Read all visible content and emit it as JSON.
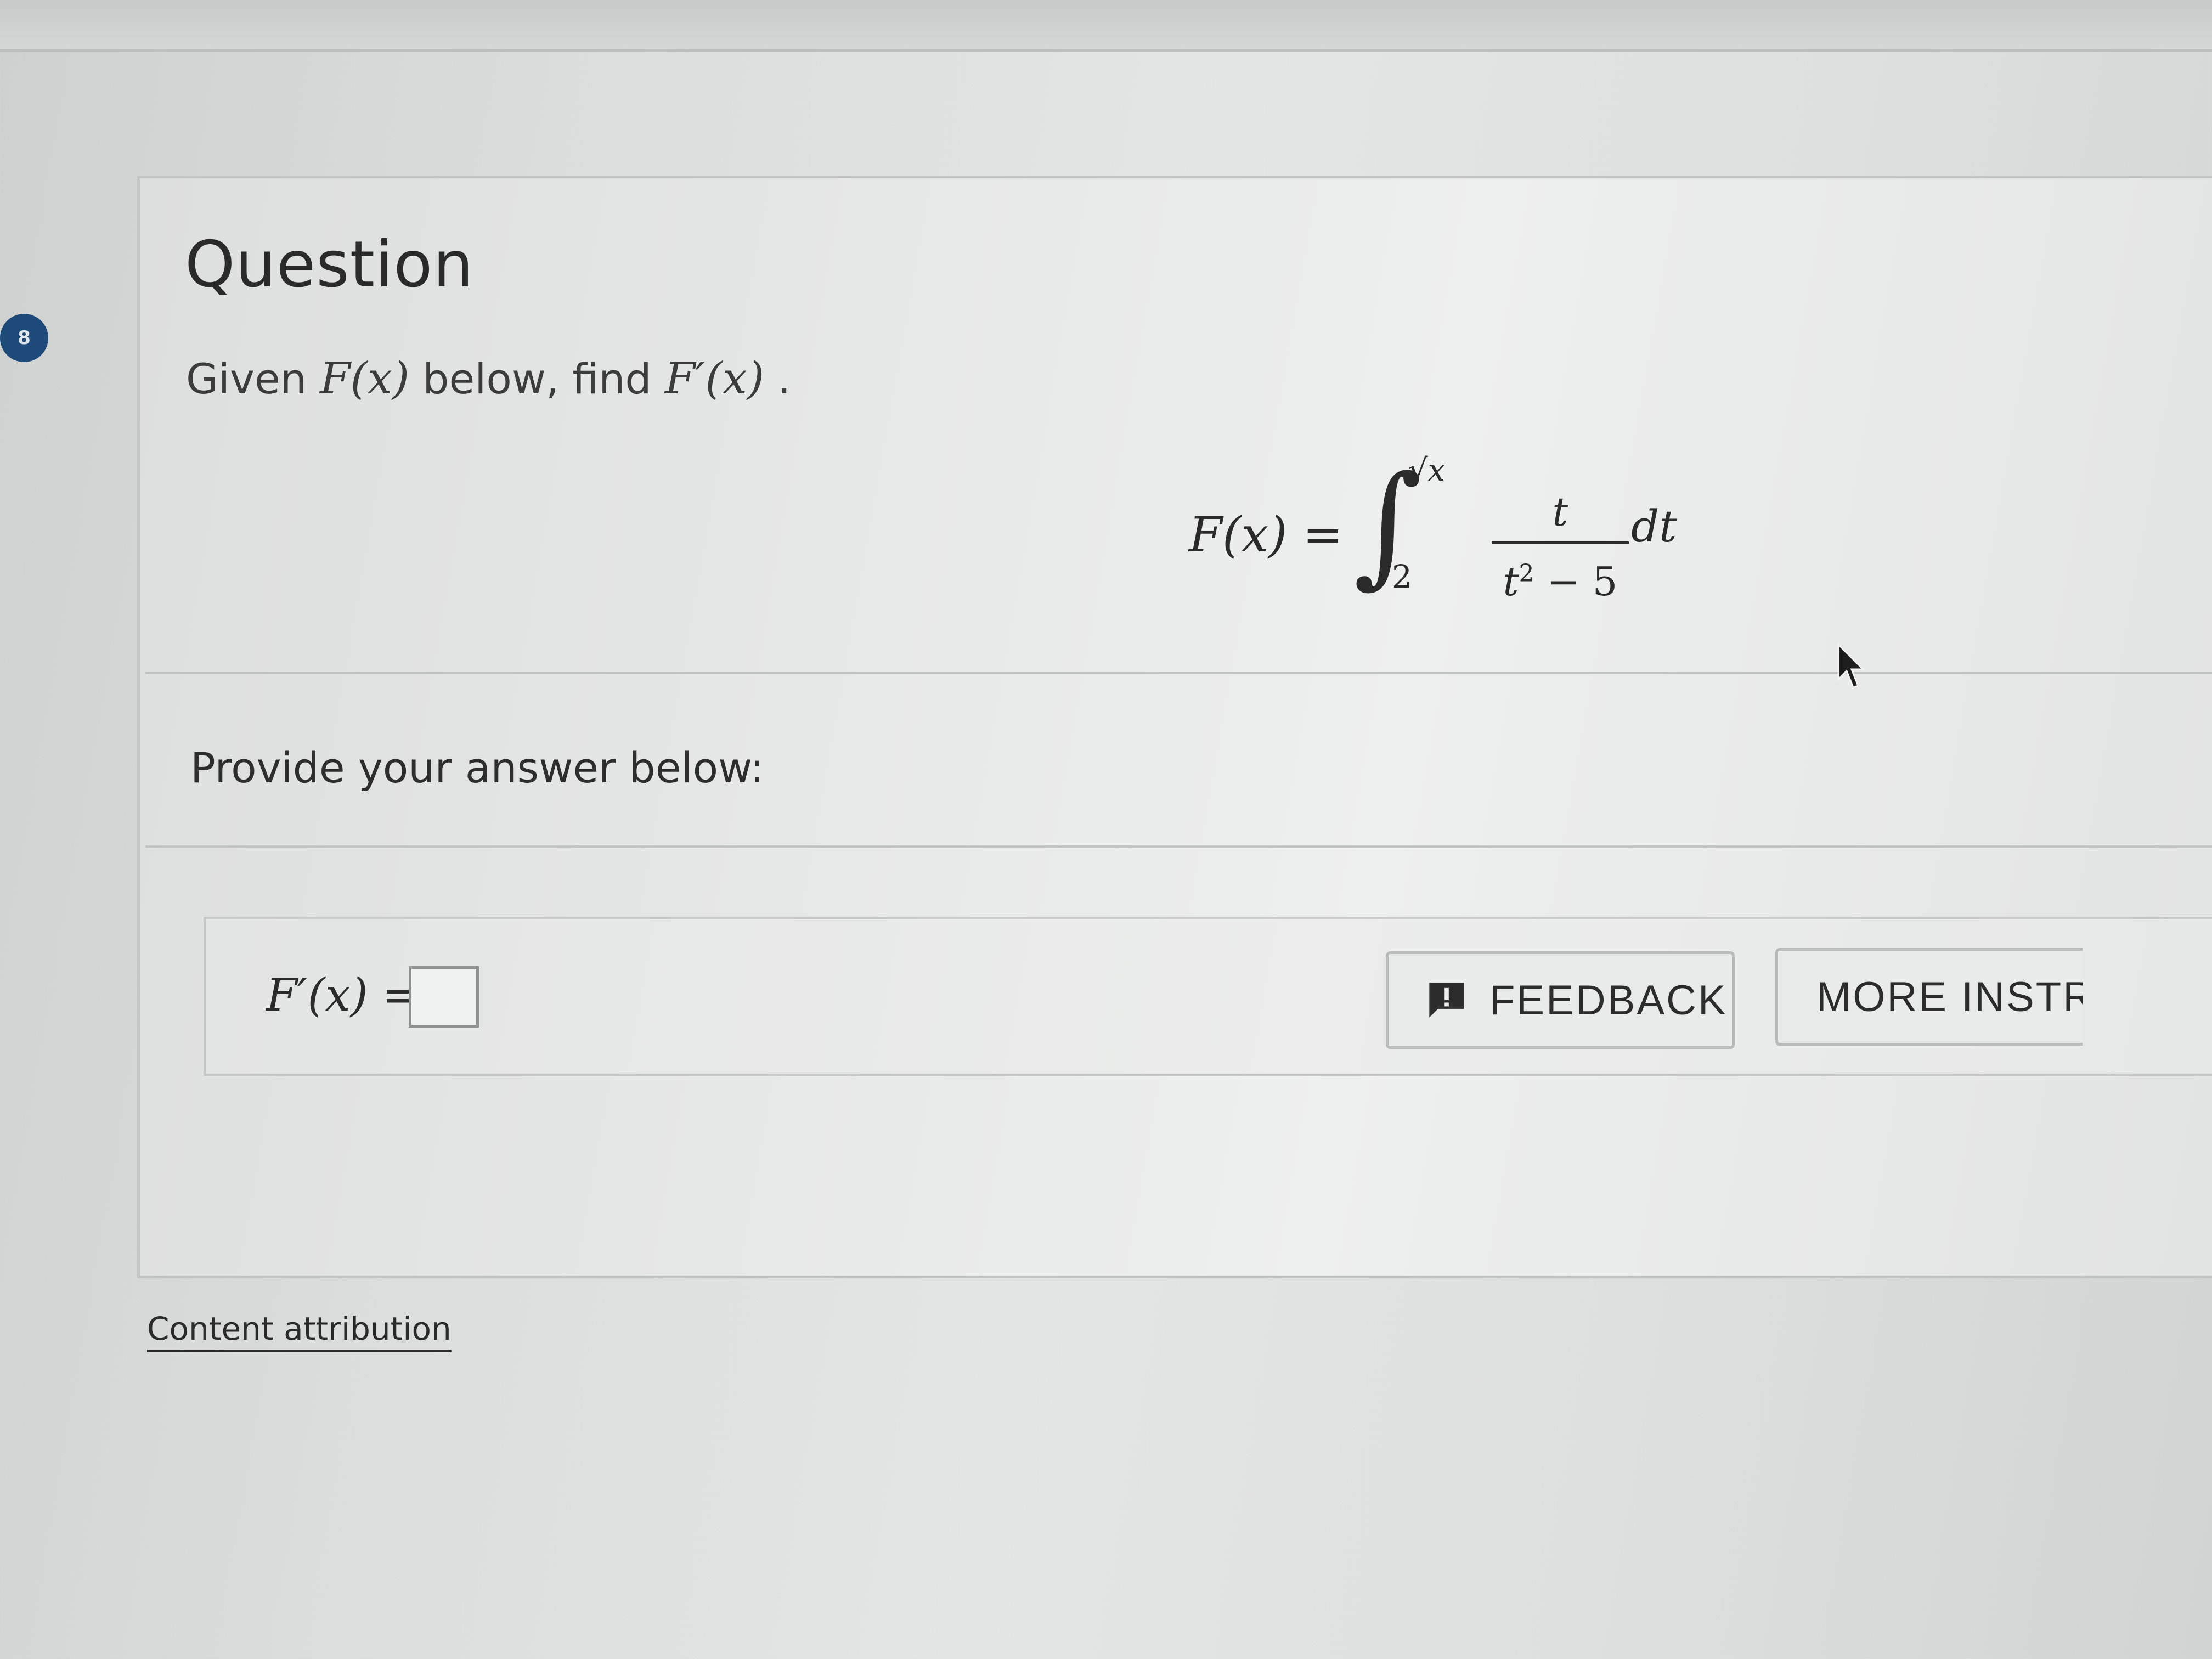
{
  "badge": {
    "number": "8"
  },
  "question": {
    "title": "Question",
    "prompt_prefix": "Given ",
    "prompt_f": "F(x)",
    "prompt_middle": " below, find ",
    "prompt_fprime": "F′(x)",
    "prompt_suffix": " ."
  },
  "formula": {
    "lhs": "F(x) =",
    "integral_symbol": "∫",
    "upper_limit": "√x",
    "lower_limit": "2",
    "numerator": "t",
    "denominator_var": "t",
    "denominator_power": "2",
    "denominator_rest": " − 5",
    "differential": "dt"
  },
  "answer": {
    "heading": "Provide your answer below:",
    "label": "F′(x) =",
    "input_value": ""
  },
  "buttons": {
    "feedback_label": "FEEDBACK",
    "more_label": "MORE INSTRU"
  },
  "footer": {
    "attribution": "Content attribution"
  },
  "icons": {
    "feedback": "feedback-icon",
    "cursor": "mouse-cursor-icon"
  }
}
